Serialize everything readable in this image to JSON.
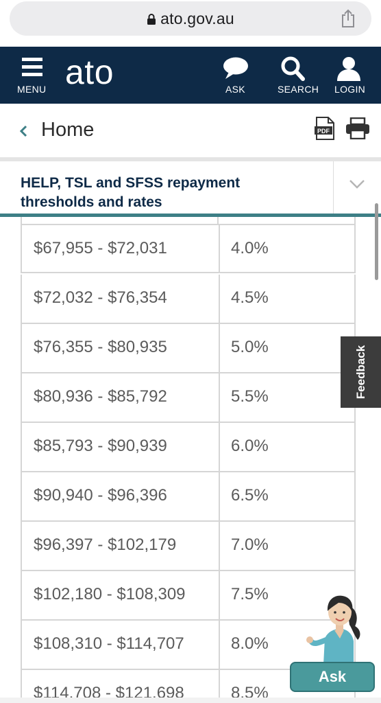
{
  "browser": {
    "url": "ato.gov.au",
    "icons": [
      "lock-icon",
      "share-icon"
    ]
  },
  "header": {
    "logo": "ato",
    "menu_label": "MENU",
    "ask_label": "ASK",
    "search_label": "SEARCH",
    "login_label": "LOGIN",
    "background_color": "#0e2a47",
    "icons": [
      "menu-icon",
      "chat-bubble-icon",
      "search-icon",
      "user-icon"
    ]
  },
  "breadcrumb": {
    "label": "Home",
    "icons": [
      "chevron-left-icon",
      "pdf-icon",
      "print-icon"
    ]
  },
  "section": {
    "title": "HELP, TSL and SFSS repayment thresholds and rates",
    "accent_color": "#3d7f86",
    "icons": [
      "chevron-down-icon"
    ]
  },
  "table": {
    "rows": [
      {
        "range": "$67,955 - $72,031",
        "rate": "4.0%"
      },
      {
        "range": "$72,032 - $76,354",
        "rate": "4.5%"
      },
      {
        "range": "$76,355 - $80,935",
        "rate": "5.0%"
      },
      {
        "range": "$80,936 - $85,792",
        "rate": "5.5%"
      },
      {
        "range": "$85,793 - $90,939",
        "rate": "6.0%"
      },
      {
        "range": "$90,940 - $96,396",
        "rate": "6.5%"
      },
      {
        "range": "$96,397 - $102,179",
        "rate": "7.0%"
      },
      {
        "range": "$102,180 - $108,309",
        "rate": "7.5%"
      },
      {
        "range": "$108,310 - $114,707",
        "rate": "8.0%"
      },
      {
        "range": "$114,708 - $121,698",
        "rate": "8.5%"
      }
    ]
  },
  "feedback": {
    "label": "Feedback"
  },
  "assistant": {
    "ask_label": "Ask",
    "button_color": "#4a9a9c"
  }
}
